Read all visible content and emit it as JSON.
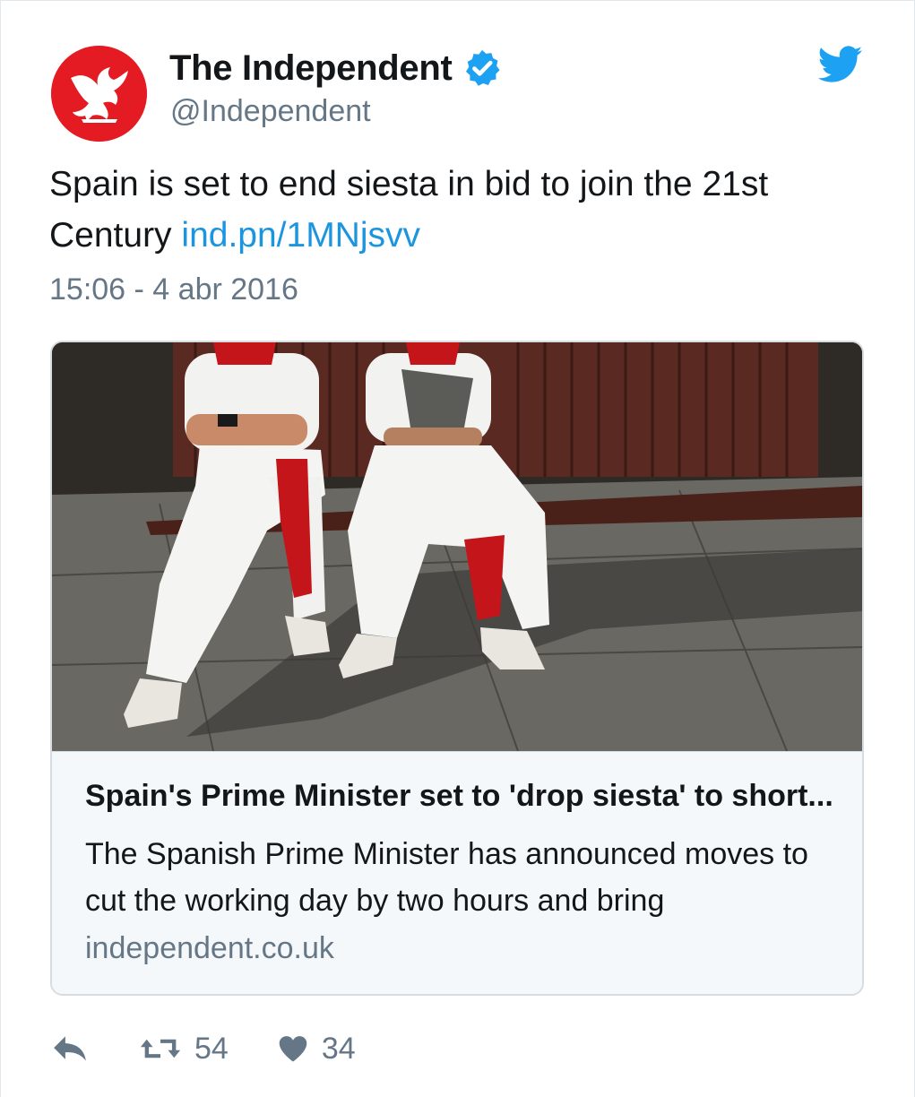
{
  "tweet": {
    "author_name": "The Independent",
    "author_handle": "@Independent",
    "text": "Spain is set to end siesta in bid to join the 21st Century ",
    "link_text": "ind.pn/1MNjsvv",
    "timestamp": "15:06 - 4 abr 2016",
    "verified": true
  },
  "card": {
    "image_alt": "",
    "title": "Spain's Prime Minister set to 'drop siesta' to short...",
    "description": "The Spanish Prime Minister has announced moves to cut the working day by two hours and bring",
    "domain": "independent.co.uk"
  },
  "actions": {
    "retweets": "54",
    "likes": "34"
  },
  "colors": {
    "link": "#1b95e0",
    "muted": "#657786",
    "brand_red": "#e51b24",
    "twitter_blue": "#1da1f2"
  },
  "icons": {
    "reply": "reply-icon",
    "retweet": "retweet-icon",
    "like": "heart-icon",
    "verified": "verified-badge-icon",
    "platform": "twitter-bird-icon"
  }
}
